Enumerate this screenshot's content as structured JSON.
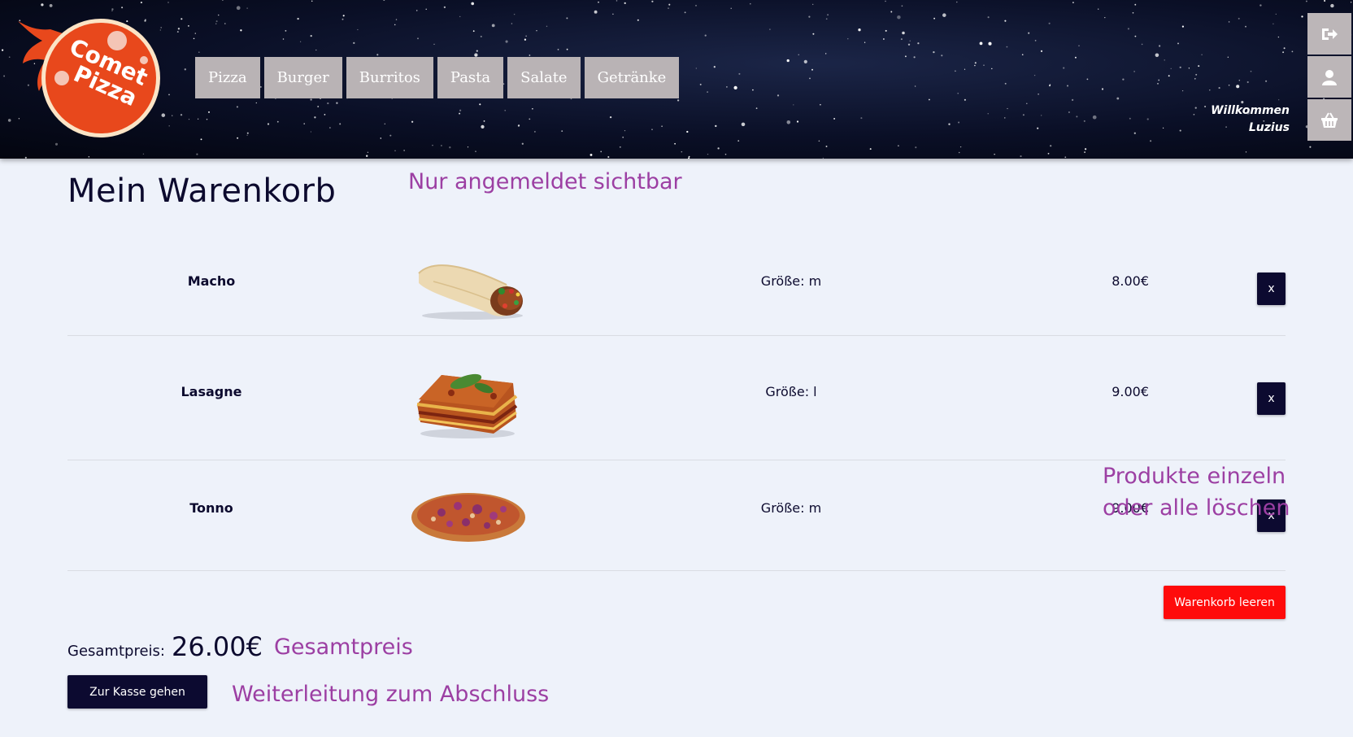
{
  "header": {
    "logo": {
      "line1": "Comet",
      "line2": "Pizza"
    },
    "nav": [
      "Pizza",
      "Burger",
      "Burritos",
      "Pasta",
      "Salate",
      "Getränke"
    ],
    "welcome_line1": "Willkommen",
    "welcome_line2": "Luzius",
    "side_buttons": [
      "logout-icon",
      "user-icon",
      "basket-icon"
    ]
  },
  "cart": {
    "title": "Mein Warenkorb",
    "items": [
      {
        "name": "Macho",
        "image": "burrito",
        "size": "Größe: m",
        "price": "8.00€",
        "remove": "x"
      },
      {
        "name": "Lasagne",
        "image": "lasagne",
        "size": "Größe: l",
        "price": "9.00€",
        "remove": "x"
      },
      {
        "name": "Tonno",
        "image": "pizza",
        "size": "Größe: m",
        "price": "9.00€",
        "remove": "x"
      }
    ],
    "clear_label": "Warenkorb leeren",
    "total_label": "Gesamtpreis:",
    "total_value": "26.00€",
    "checkout_label": "Zur Kasse gehen"
  },
  "annotations": {
    "login": "Nur angemeldet sichtbar",
    "delete": "Produkte einzeln oder alle löschen",
    "total": "Gesamtpreis",
    "checkout": "Weiterleitung zum Abschluss"
  },
  "colors": {
    "primary_dark": "#0c0a30",
    "danger": "#ff0b0b",
    "annotation": "#9c3fa3",
    "nav_button": "#b9b3b5",
    "logo_red": "#e8481c"
  }
}
